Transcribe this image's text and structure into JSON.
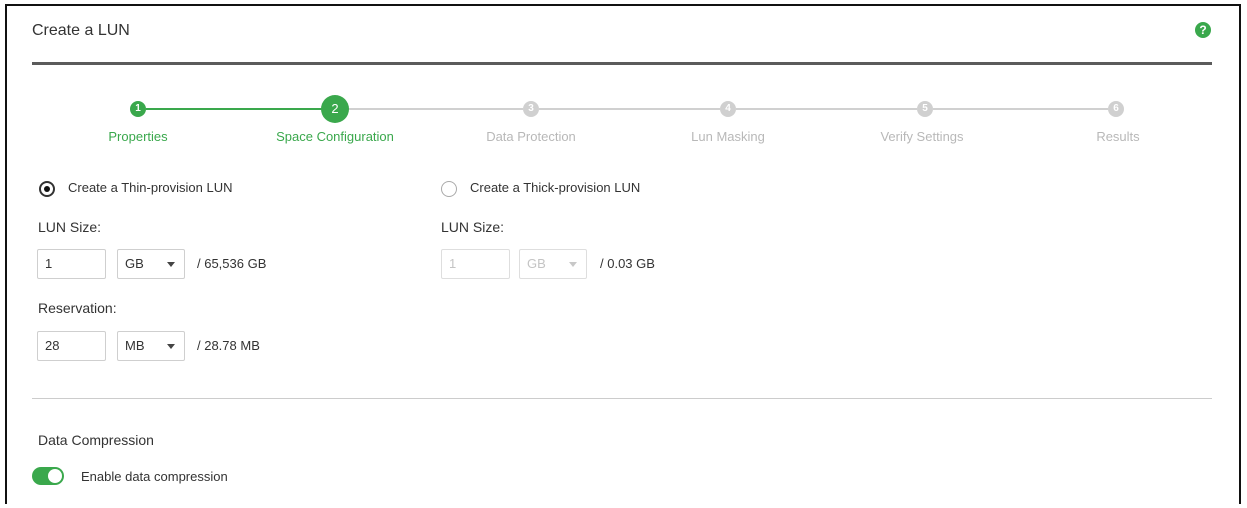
{
  "window": {
    "title": "Create a LUN",
    "help_icon": "question-circle-icon",
    "help_glyph": "?"
  },
  "colors": {
    "accent": "#3aa84c",
    "inactive_step": "#d0d0d0",
    "inactive_text": "#b8b8b8"
  },
  "stepper": {
    "current": 2,
    "steps": [
      {
        "num": "1",
        "label": "Properties",
        "state": "completed"
      },
      {
        "num": "2",
        "label": "Space Configuration",
        "state": "current"
      },
      {
        "num": "3",
        "label": "Data Protection",
        "state": "pending"
      },
      {
        "num": "4",
        "label": "Lun Masking",
        "state": "pending"
      },
      {
        "num": "5",
        "label": "Verify Settings",
        "state": "pending"
      },
      {
        "num": "6",
        "label": "Results",
        "state": "pending"
      }
    ]
  },
  "thin": {
    "radio_label": "Create a Thin-provision LUN",
    "selected": true,
    "lun_size_label": "LUN Size:",
    "lun_size_value": "1",
    "lun_size_unit": "GB",
    "lun_size_max": "/ 65,536 GB",
    "reservation_label": "Reservation:",
    "reservation_value": "28",
    "reservation_unit": "MB",
    "reservation_max": "/ 28.78 MB"
  },
  "thick": {
    "radio_label": "Create a Thick-provision LUN",
    "selected": false,
    "lun_size_label": "LUN Size:",
    "lun_size_placeholder": "1",
    "lun_size_unit": "GB",
    "lun_size_max": "/ 0.03 GB"
  },
  "compression": {
    "section_title": "Data Compression",
    "toggle_label": "Enable data compression",
    "enabled": true
  }
}
